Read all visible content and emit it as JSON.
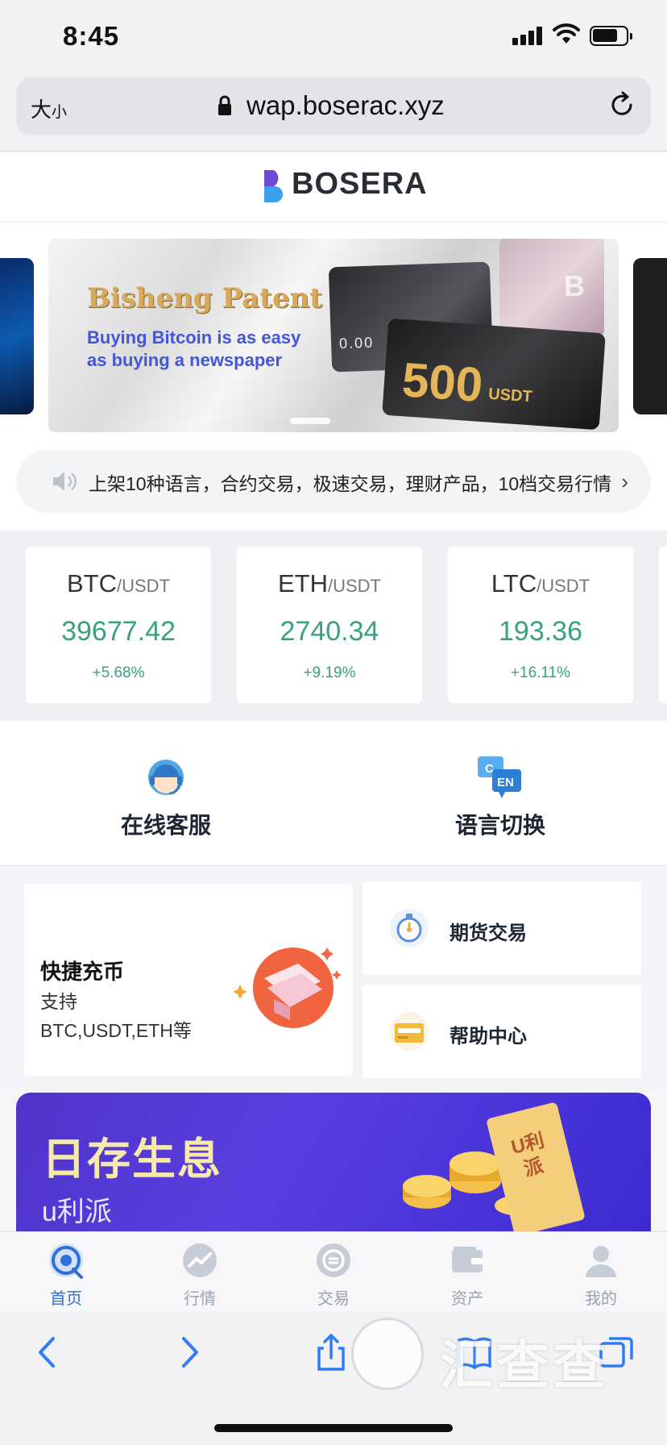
{
  "status_bar": {
    "time": "8:45"
  },
  "browser": {
    "text_size_label": "大",
    "text_size_small": "小",
    "url": "wap.boserac.xyz"
  },
  "brand": {
    "name": "BOSERA"
  },
  "banner": {
    "title": "Bisheng Patent",
    "subtitle_line1": "Buying Bitcoin is as easy",
    "subtitle_line2": "as buying a newspaper",
    "card_number": "0.00",
    "card_amount": "500",
    "card_currency": "USDT",
    "card_symbol": "B"
  },
  "notice": {
    "text": "上架10种语言，合约交易，极速交易，理财产品，10档交易行情"
  },
  "tickers": [
    {
      "base": "BTC",
      "quote": "/USDT",
      "price": "39677.42",
      "change": "+5.68%"
    },
    {
      "base": "ETH",
      "quote": "/USDT",
      "price": "2740.34",
      "change": "+9.19%"
    },
    {
      "base": "LTC",
      "quote": "/USDT",
      "price": "193.36",
      "change": "+16.11%"
    }
  ],
  "quick": {
    "support": "在线客服",
    "language": "语言切换",
    "lang_icon_c": "C",
    "lang_icon_en": "EN"
  },
  "deposit": {
    "title": "快捷充币",
    "line1": "支持",
    "line2": "BTC,USDT,ETH等"
  },
  "futures": {
    "label": "期货交易"
  },
  "help": {
    "label": "帮助中心"
  },
  "promo": {
    "title": "日存生息",
    "subtitle": "u利派",
    "ticket": "U利派"
  },
  "tabbar": [
    {
      "label": "首页",
      "active": true
    },
    {
      "label": "行情"
    },
    {
      "label": "交易"
    },
    {
      "label": "资产"
    },
    {
      "label": "我的"
    }
  ],
  "watermark": {
    "text": "汇查查"
  },
  "colors": {
    "accent_blue": "#2f6fd8",
    "up_green": "#3aa27a",
    "promo_purple": "#5a3fe0"
  }
}
